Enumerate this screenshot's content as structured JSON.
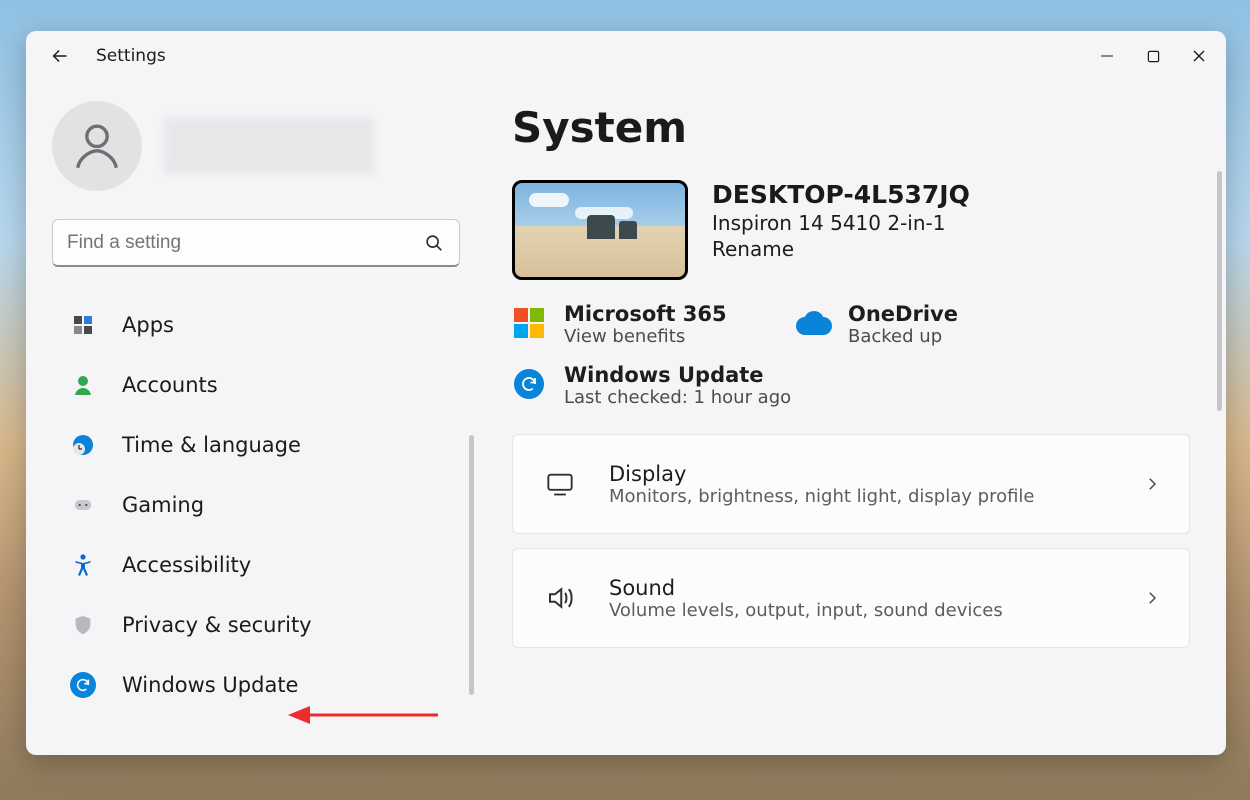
{
  "app_title": "Settings",
  "search": {
    "placeholder": "Find a setting"
  },
  "sidebar": {
    "items": [
      {
        "label": "Apps"
      },
      {
        "label": "Accounts"
      },
      {
        "label": "Time & language"
      },
      {
        "label": "Gaming"
      },
      {
        "label": "Accessibility"
      },
      {
        "label": "Privacy & security"
      },
      {
        "label": "Windows Update"
      }
    ]
  },
  "page": {
    "title": "System",
    "device": {
      "name": "DESKTOP-4L537JQ",
      "model": "Inspiron 14 5410 2-in-1",
      "rename": "Rename"
    },
    "tiles": {
      "m365": {
        "title": "Microsoft 365",
        "sub": "View benefits"
      },
      "onedrive": {
        "title": "OneDrive",
        "sub": "Backed up"
      },
      "winupdate": {
        "title": "Windows Update",
        "sub": "Last checked: 1 hour ago"
      }
    },
    "cards": [
      {
        "title": "Display",
        "sub": "Monitors, brightness, night light, display profile"
      },
      {
        "title": "Sound",
        "sub": "Volume levels, output, input, sound devices"
      }
    ]
  }
}
